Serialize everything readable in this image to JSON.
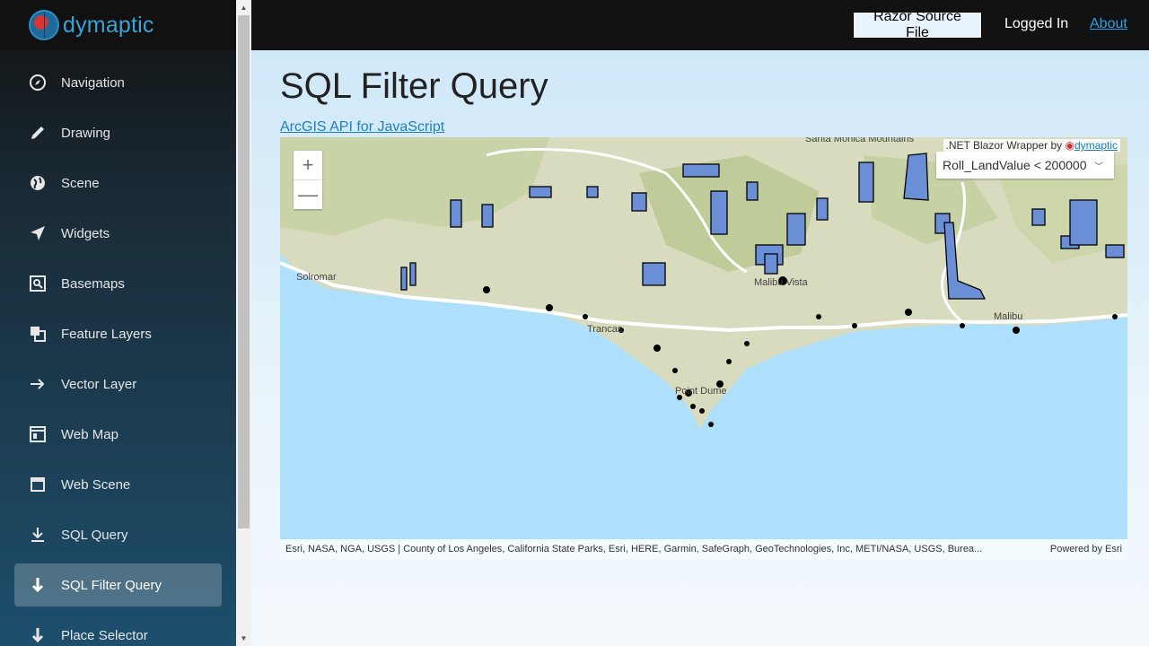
{
  "brand": {
    "name": "dymaptic"
  },
  "sidebar": {
    "items": [
      {
        "label": "Navigation",
        "icon": "compass-icon"
      },
      {
        "label": "Drawing",
        "icon": "pencil-icon"
      },
      {
        "label": "Scene",
        "icon": "globe-icon"
      },
      {
        "label": "Widgets",
        "icon": "location-arrow-icon"
      },
      {
        "label": "Basemaps",
        "icon": "map-frame-icon"
      },
      {
        "label": "Feature Layers",
        "icon": "layers-icon"
      },
      {
        "label": "Vector Layer",
        "icon": "arrow-right-icon"
      },
      {
        "label": "Web Map",
        "icon": "window-icon"
      },
      {
        "label": "Web Scene",
        "icon": "browser-window-icon"
      },
      {
        "label": "SQL Query",
        "icon": "download-icon"
      },
      {
        "label": "SQL Filter Query",
        "icon": "arrow-down-icon",
        "active": true
      },
      {
        "label": "Place Selector",
        "icon": "arrow-down-icon"
      }
    ]
  },
  "topbar": {
    "razor_button": "Razor Source File",
    "logged_in": "Logged In",
    "about": "About"
  },
  "main": {
    "title": "SQL Filter Query",
    "api_link": "ArcGIS API for JavaScript"
  },
  "map": {
    "zoom_in": "+",
    "zoom_out": "—",
    "wrapper_credit_prefix": ".NET Blazor Wrapper by",
    "wrapper_credit_link": "dymaptic",
    "filter_value": "Roll_LandValue < 200000",
    "attribution": "Esri, NASA, NGA, USGS | County of Los Angeles, California State Parks, Esri, HERE, Garmin, SafeGraph, GeoTechnologies, Inc, METI/NASA, USGS, Burea...",
    "powered_by": "Powered by Esri",
    "place_labels": [
      "Solromar",
      "Malibu Vista",
      "Malibu",
      "Trancas",
      "Point Dume",
      "Santa Monica Mountains"
    ],
    "colors": {
      "parcel_fill": "#6b8fd6",
      "parcel_stroke": "#000000",
      "ocean": "#aee0fb",
      "land": "#d9dcc0"
    }
  }
}
